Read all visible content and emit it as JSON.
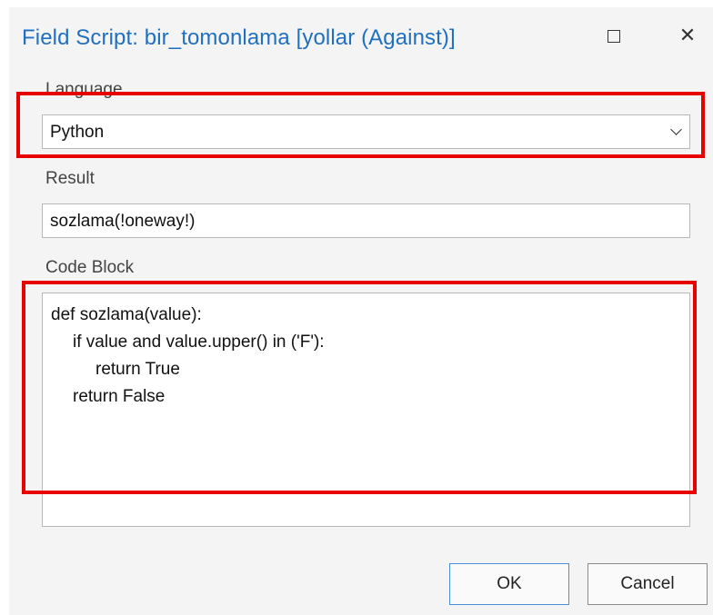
{
  "dialog": {
    "title": "Field Script: bir_tomonlama [yollar (Against)]",
    "maximize_icon": "maximize-icon",
    "close_icon": "close-icon",
    "close_glyph": "✕"
  },
  "language": {
    "label": "Language",
    "selected": "Python"
  },
  "result": {
    "label": "Result",
    "value": "sozlama(!oneway!)"
  },
  "code_block": {
    "label": "Code Block",
    "lines": [
      "def sozlama(value):",
      "if value and value.upper() in ('F'):",
      "return True",
      "return False"
    ]
  },
  "buttons": {
    "ok": "OK",
    "cancel": "Cancel"
  },
  "colors": {
    "title": "#2170c0",
    "highlight": "#e60000",
    "ok_border": "#4a90d9"
  }
}
